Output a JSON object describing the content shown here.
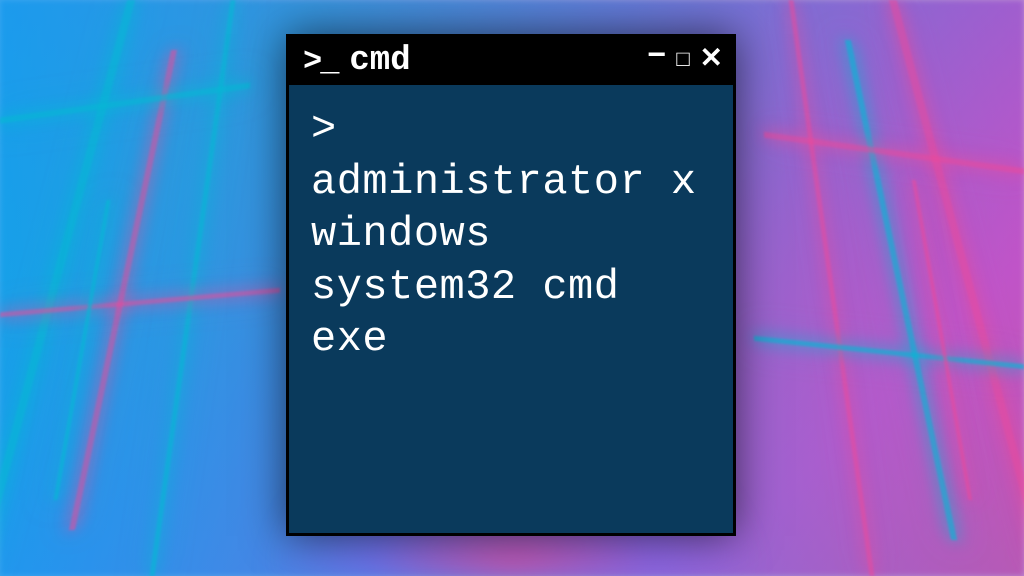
{
  "window": {
    "title": "cmd",
    "icon_glyph": ">_"
  },
  "terminal": {
    "prompt": ">",
    "command": "administrator x windows system32 cmd exe"
  },
  "controls": {
    "minimize": "−",
    "maximize": "□",
    "close": "✕"
  }
}
